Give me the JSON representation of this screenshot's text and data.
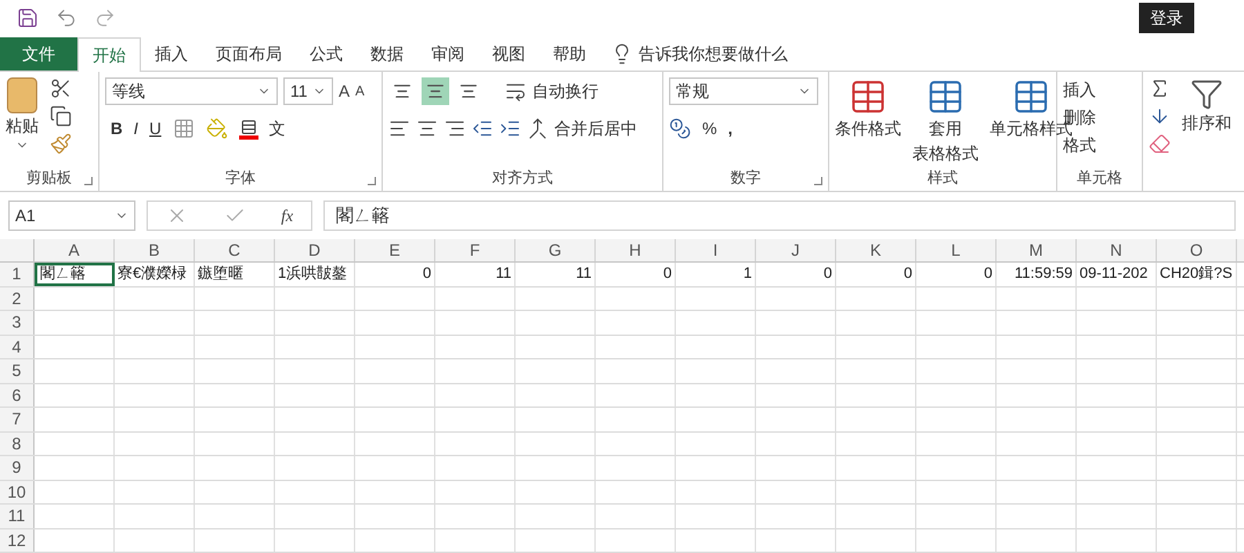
{
  "title_bar": {
    "sign_in": "登录"
  },
  "tabs": [
    {
      "label": "文件",
      "kind": "file",
      "selected": false
    },
    {
      "label": "开始",
      "kind": "tab",
      "selected": true
    },
    {
      "label": "插入",
      "kind": "tab",
      "selected": false
    },
    {
      "label": "页面布局",
      "kind": "tab",
      "selected": false
    },
    {
      "label": "公式",
      "kind": "tab",
      "selected": false
    },
    {
      "label": "数据",
      "kind": "tab",
      "selected": false
    },
    {
      "label": "审阅",
      "kind": "tab",
      "selected": false
    },
    {
      "label": "视图",
      "kind": "tab",
      "selected": false
    },
    {
      "label": "帮助",
      "kind": "tab",
      "selected": false
    }
  ],
  "tell_me": "告诉我你想要做什么",
  "ribbon": {
    "clipboard": {
      "label": "剪贴板",
      "paste": "粘贴"
    },
    "font": {
      "label": "字体",
      "font_name": "等线",
      "font_size": "11",
      "grow": "A",
      "shrink": "A",
      "bold": "B",
      "italic": "I",
      "underline": "U",
      "wen": "文"
    },
    "alignment": {
      "label": "对齐方式",
      "vertical": [
        {
          "selected": false
        },
        {
          "selected": true
        },
        {
          "selected": false
        }
      ],
      "wrap": "自动换行",
      "merge": "合并后居中"
    },
    "number": {
      "label": "数字",
      "format": "常规",
      "percent": "%",
      "comma": ","
    },
    "styles": {
      "label": "样式",
      "conditional": "条件格式",
      "table_1": "套用",
      "table_2": "表格格式",
      "cell_styles": "单元格样式"
    },
    "cells": {
      "label": "单元格",
      "insert": "插入",
      "delete": "删除",
      "format": "格式"
    },
    "editing": {
      "sort": "排序和"
    }
  },
  "formula_bar": {
    "name_box": "A1",
    "fx": "fx",
    "content": "閣ㄥ簵"
  },
  "sheet": {
    "columns": [
      "A",
      "B",
      "C",
      "D",
      "E",
      "F",
      "G",
      "H",
      "I",
      "J",
      "K",
      "L",
      "M",
      "N",
      "O"
    ],
    "rows": [
      {
        "header": "1",
        "cells": [
          {
            "text": "閣ㄥ簵",
            "kind": "text",
            "selected": true
          },
          {
            "text": "寮€濮嬫椂",
            "kind": "text",
            "selected": false
          },
          {
            "text": "鏃堕暱",
            "kind": "text",
            "selected": false
          },
          {
            "text": "1浜哄皵鏊",
            "kind": "text",
            "selected": false
          },
          {
            "text": "0",
            "kind": "number",
            "selected": false
          },
          {
            "text": "11",
            "kind": "number",
            "selected": false
          },
          {
            "text": "11",
            "kind": "number",
            "selected": false
          },
          {
            "text": "0",
            "kind": "number",
            "selected": false
          },
          {
            "text": "1",
            "kind": "number",
            "selected": false
          },
          {
            "text": "0",
            "kind": "number",
            "selected": false
          },
          {
            "text": "0",
            "kind": "number",
            "selected": false
          },
          {
            "text": "0",
            "kind": "number",
            "selected": false
          },
          {
            "text": "11:59:59",
            "kind": "number",
            "selected": false
          },
          {
            "text": "09-11-202",
            "kind": "text",
            "selected": false
          },
          {
            "text": "CH20鍓?S",
            "kind": "text",
            "selected": false
          }
        ]
      },
      {
        "header": "2",
        "cells": []
      },
      {
        "header": "3",
        "cells": []
      },
      {
        "header": "4",
        "cells": []
      },
      {
        "header": "5",
        "cells": []
      },
      {
        "header": "6",
        "cells": []
      },
      {
        "header": "7",
        "cells": []
      },
      {
        "header": "8",
        "cells": []
      },
      {
        "header": "9",
        "cells": []
      },
      {
        "header": "10",
        "cells": []
      },
      {
        "header": "11",
        "cells": []
      },
      {
        "header": "12",
        "cells": []
      }
    ]
  }
}
